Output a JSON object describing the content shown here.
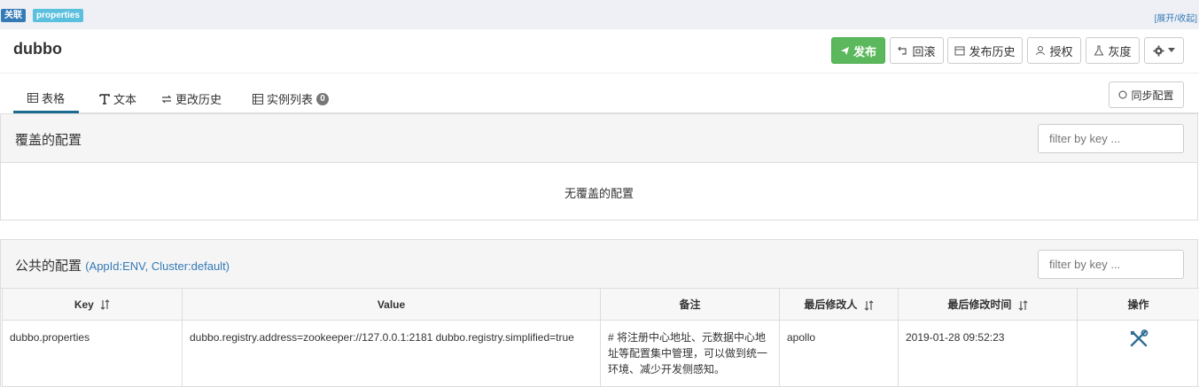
{
  "topbar": {
    "tags": [
      "关联",
      "properties"
    ],
    "expand_toggle": "[展开/收起]"
  },
  "app": {
    "name": "dubbo"
  },
  "toolbar": {
    "publish": "发布",
    "rollback": "回滚",
    "history": "发布历史",
    "authorize": "授权",
    "gray": "灰度"
  },
  "tabs": [
    {
      "label": "表格",
      "active": true
    },
    {
      "label": "文本",
      "active": false
    },
    {
      "label": "更改历史",
      "active": false
    },
    {
      "label": "实例列表",
      "active": false,
      "badge": "0"
    }
  ],
  "sync": {
    "label": "同步配置"
  },
  "override_section": {
    "title": "覆盖的配置",
    "filter_placeholder": "filter by key ...",
    "empty_text": "无覆盖的配置"
  },
  "public_section": {
    "title": "公共的配置",
    "subtitle": "(AppId:ENV, Cluster:default)",
    "filter_placeholder": "filter by key ..."
  },
  "table": {
    "headers": [
      "Key",
      "Value",
      "备注",
      "最后修改人",
      "最后修改时间",
      "操作"
    ],
    "rows": [
      {
        "key": "dubbo.properties",
        "value": "dubbo.registry.address=zookeeper://127.0.0.1:2181 dubbo.registry.simplified=true",
        "comment": "# 将注册中心地址、元数据中心地址等配置集中管理，可以做到统一环境、减少开发侧感知。",
        "modifier": "apollo",
        "modified_time": "2019-01-28 09:52:23"
      }
    ]
  },
  "colors": {
    "primary": "#337ab7",
    "success": "#5cb85c",
    "info": "#5bc0de",
    "tab_active": "#1a6b8f"
  }
}
